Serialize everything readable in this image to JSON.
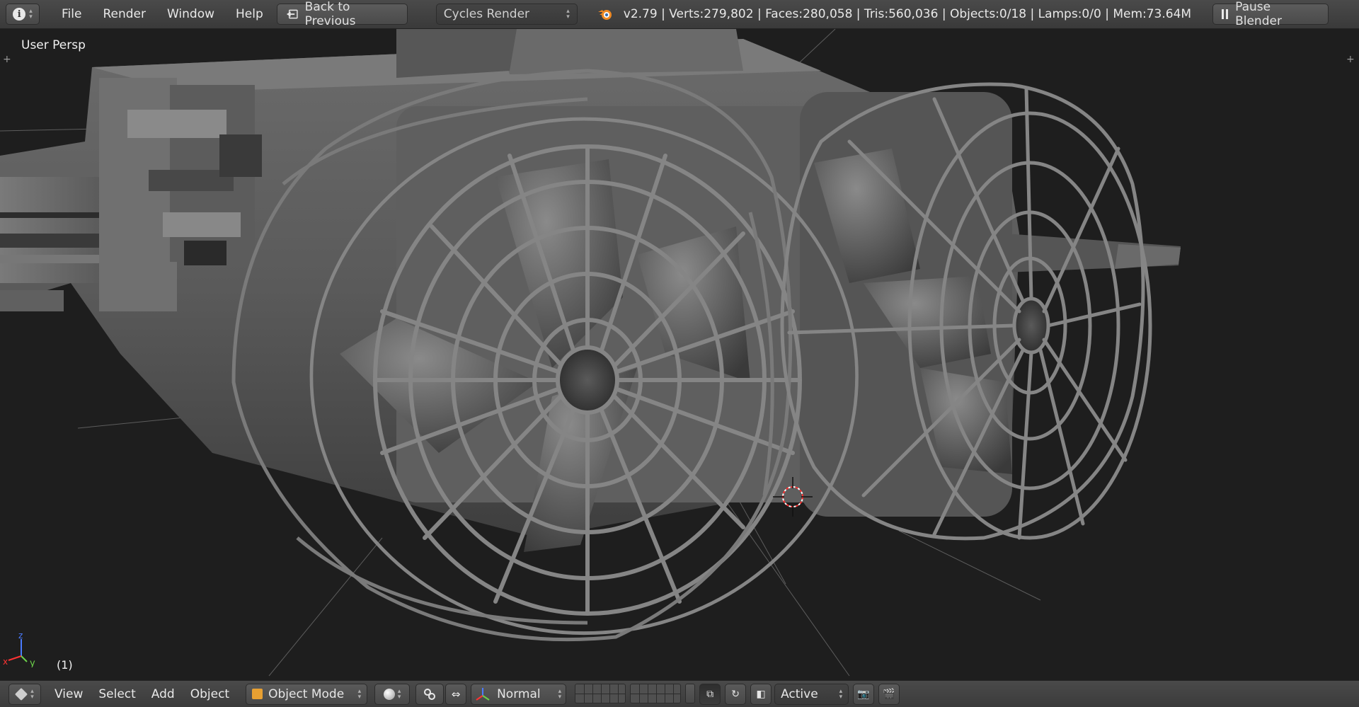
{
  "topbar": {
    "editor_icon": "info-icon",
    "menu": [
      "File",
      "Render",
      "Window",
      "Help"
    ],
    "back_label": "Back to Previous",
    "render_engine": "Cycles Render",
    "stats": "v2.79 | Verts:279,802 | Faces:280,058 | Tris:560,036 | Objects:0/18 | Lamps:0/0 | Mem:73.64M",
    "pause_label": "Pause Blender"
  },
  "viewport": {
    "view_label": "User Persp",
    "frame_label": "(1)",
    "axis_labels": {
      "x": "x",
      "y": "y",
      "z": "z"
    }
  },
  "bottombar": {
    "editor_icon": "cube-icon",
    "menu": [
      "View",
      "Select",
      "Add",
      "Object"
    ],
    "mode": "Object Mode",
    "orientation": "Normal",
    "snap_target": "Active"
  },
  "colors": {
    "header_bg": "#3f3f3f",
    "viewport_bg": "#1e1e1e",
    "axis_x": "#ff3333",
    "axis_y": "#6bd04a",
    "axis_z": "#4a7bff",
    "blender_orange": "#f08a24"
  }
}
